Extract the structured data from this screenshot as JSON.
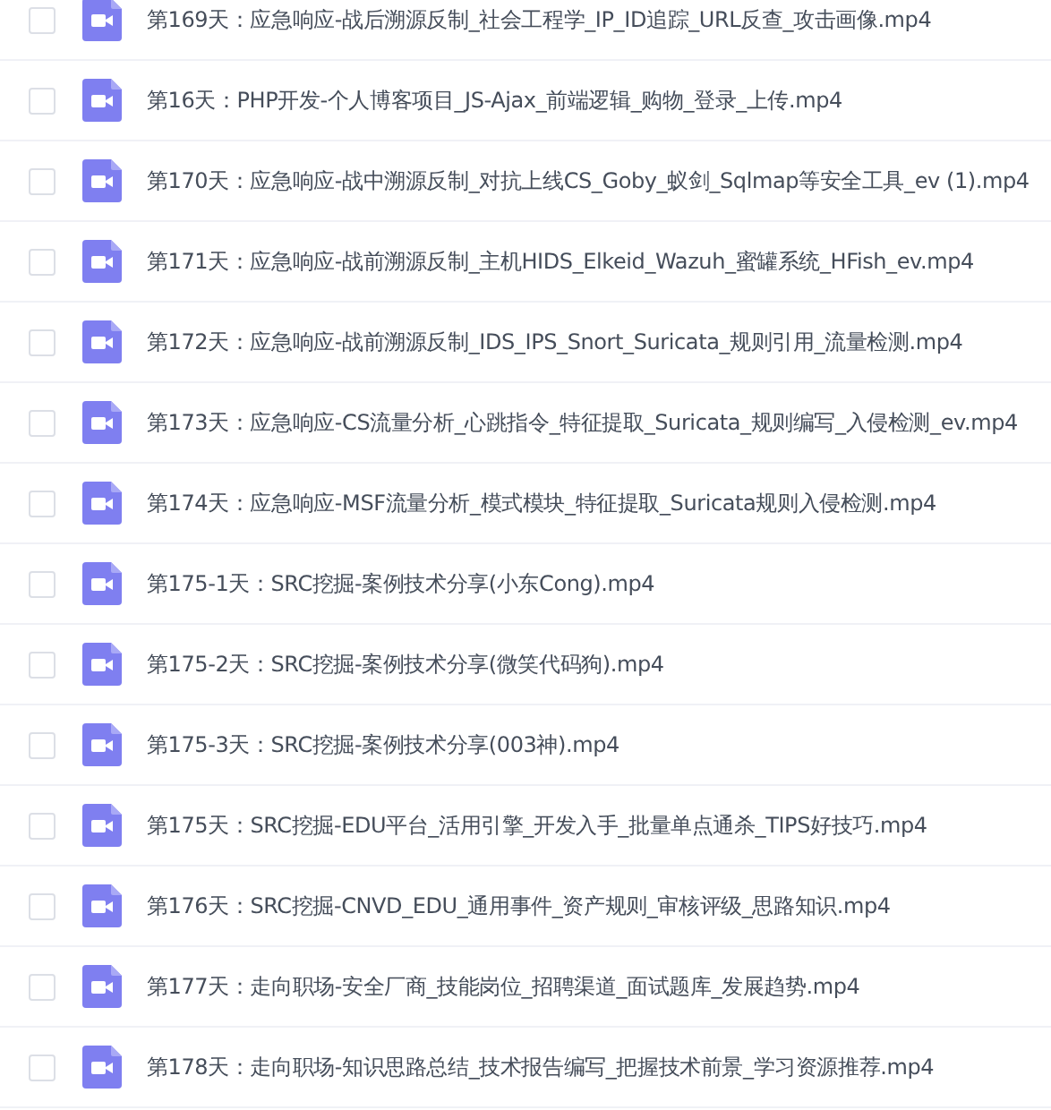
{
  "files": [
    {
      "name": "第169天：应急响应-战后溯源反制_社会工程学_IP_ID追踪_URL反查_攻击画像.mp4",
      "checked": false
    },
    {
      "name": "第16天：PHP开发-个人博客项目_JS-Ajax_前端逻辑_购物_登录_上传.mp4",
      "checked": false
    },
    {
      "name": "第170天：应急响应-战中溯源反制_对抗上线CS_Goby_蚁剑_Sqlmap等安全工具_ev (1).mp4",
      "checked": false
    },
    {
      "name": "第171天：应急响应-战前溯源反制_主机HIDS_Elkeid_Wazuh_蜜罐系统_HFish_ev.mp4",
      "checked": false
    },
    {
      "name": "第172天：应急响应-战前溯源反制_IDS_IPS_Snort_Suricata_规则引用_流量检测.mp4",
      "checked": false
    },
    {
      "name": "第173天：应急响应-CS流量分析_心跳指令_特征提取_Suricata_规则编写_入侵检测_ev.mp4",
      "checked": false
    },
    {
      "name": "第174天：应急响应-MSF流量分析_模式模块_特征提取_Suricata规则入侵检测.mp4",
      "checked": false
    },
    {
      "name": "第175-1天：SRC挖掘-案例技术分享(小东Cong).mp4",
      "checked": false
    },
    {
      "name": "第175-2天：SRC挖掘-案例技术分享(微笑代码狗).mp4",
      "checked": false
    },
    {
      "name": "第175-3天：SRC挖掘-案例技术分享(003神).mp4",
      "checked": false
    },
    {
      "name": "第175天：SRC挖掘-EDU平台_活用引擎_开发入手_批量单点通杀_TIPS好技巧.mp4",
      "checked": false
    },
    {
      "name": "第176天：SRC挖掘-CNVD_EDU_通用事件_资产规则_审核评级_思路知识.mp4",
      "checked": false
    },
    {
      "name": "第177天：走向职场-安全厂商_技能岗位_招聘渠道_面试题库_发展趋势.mp4",
      "checked": false
    },
    {
      "name": "第178天：走向职场-知识思路总结_技术报告编写_把握技术前景_学习资源推荐.mp4",
      "checked": false
    }
  ]
}
